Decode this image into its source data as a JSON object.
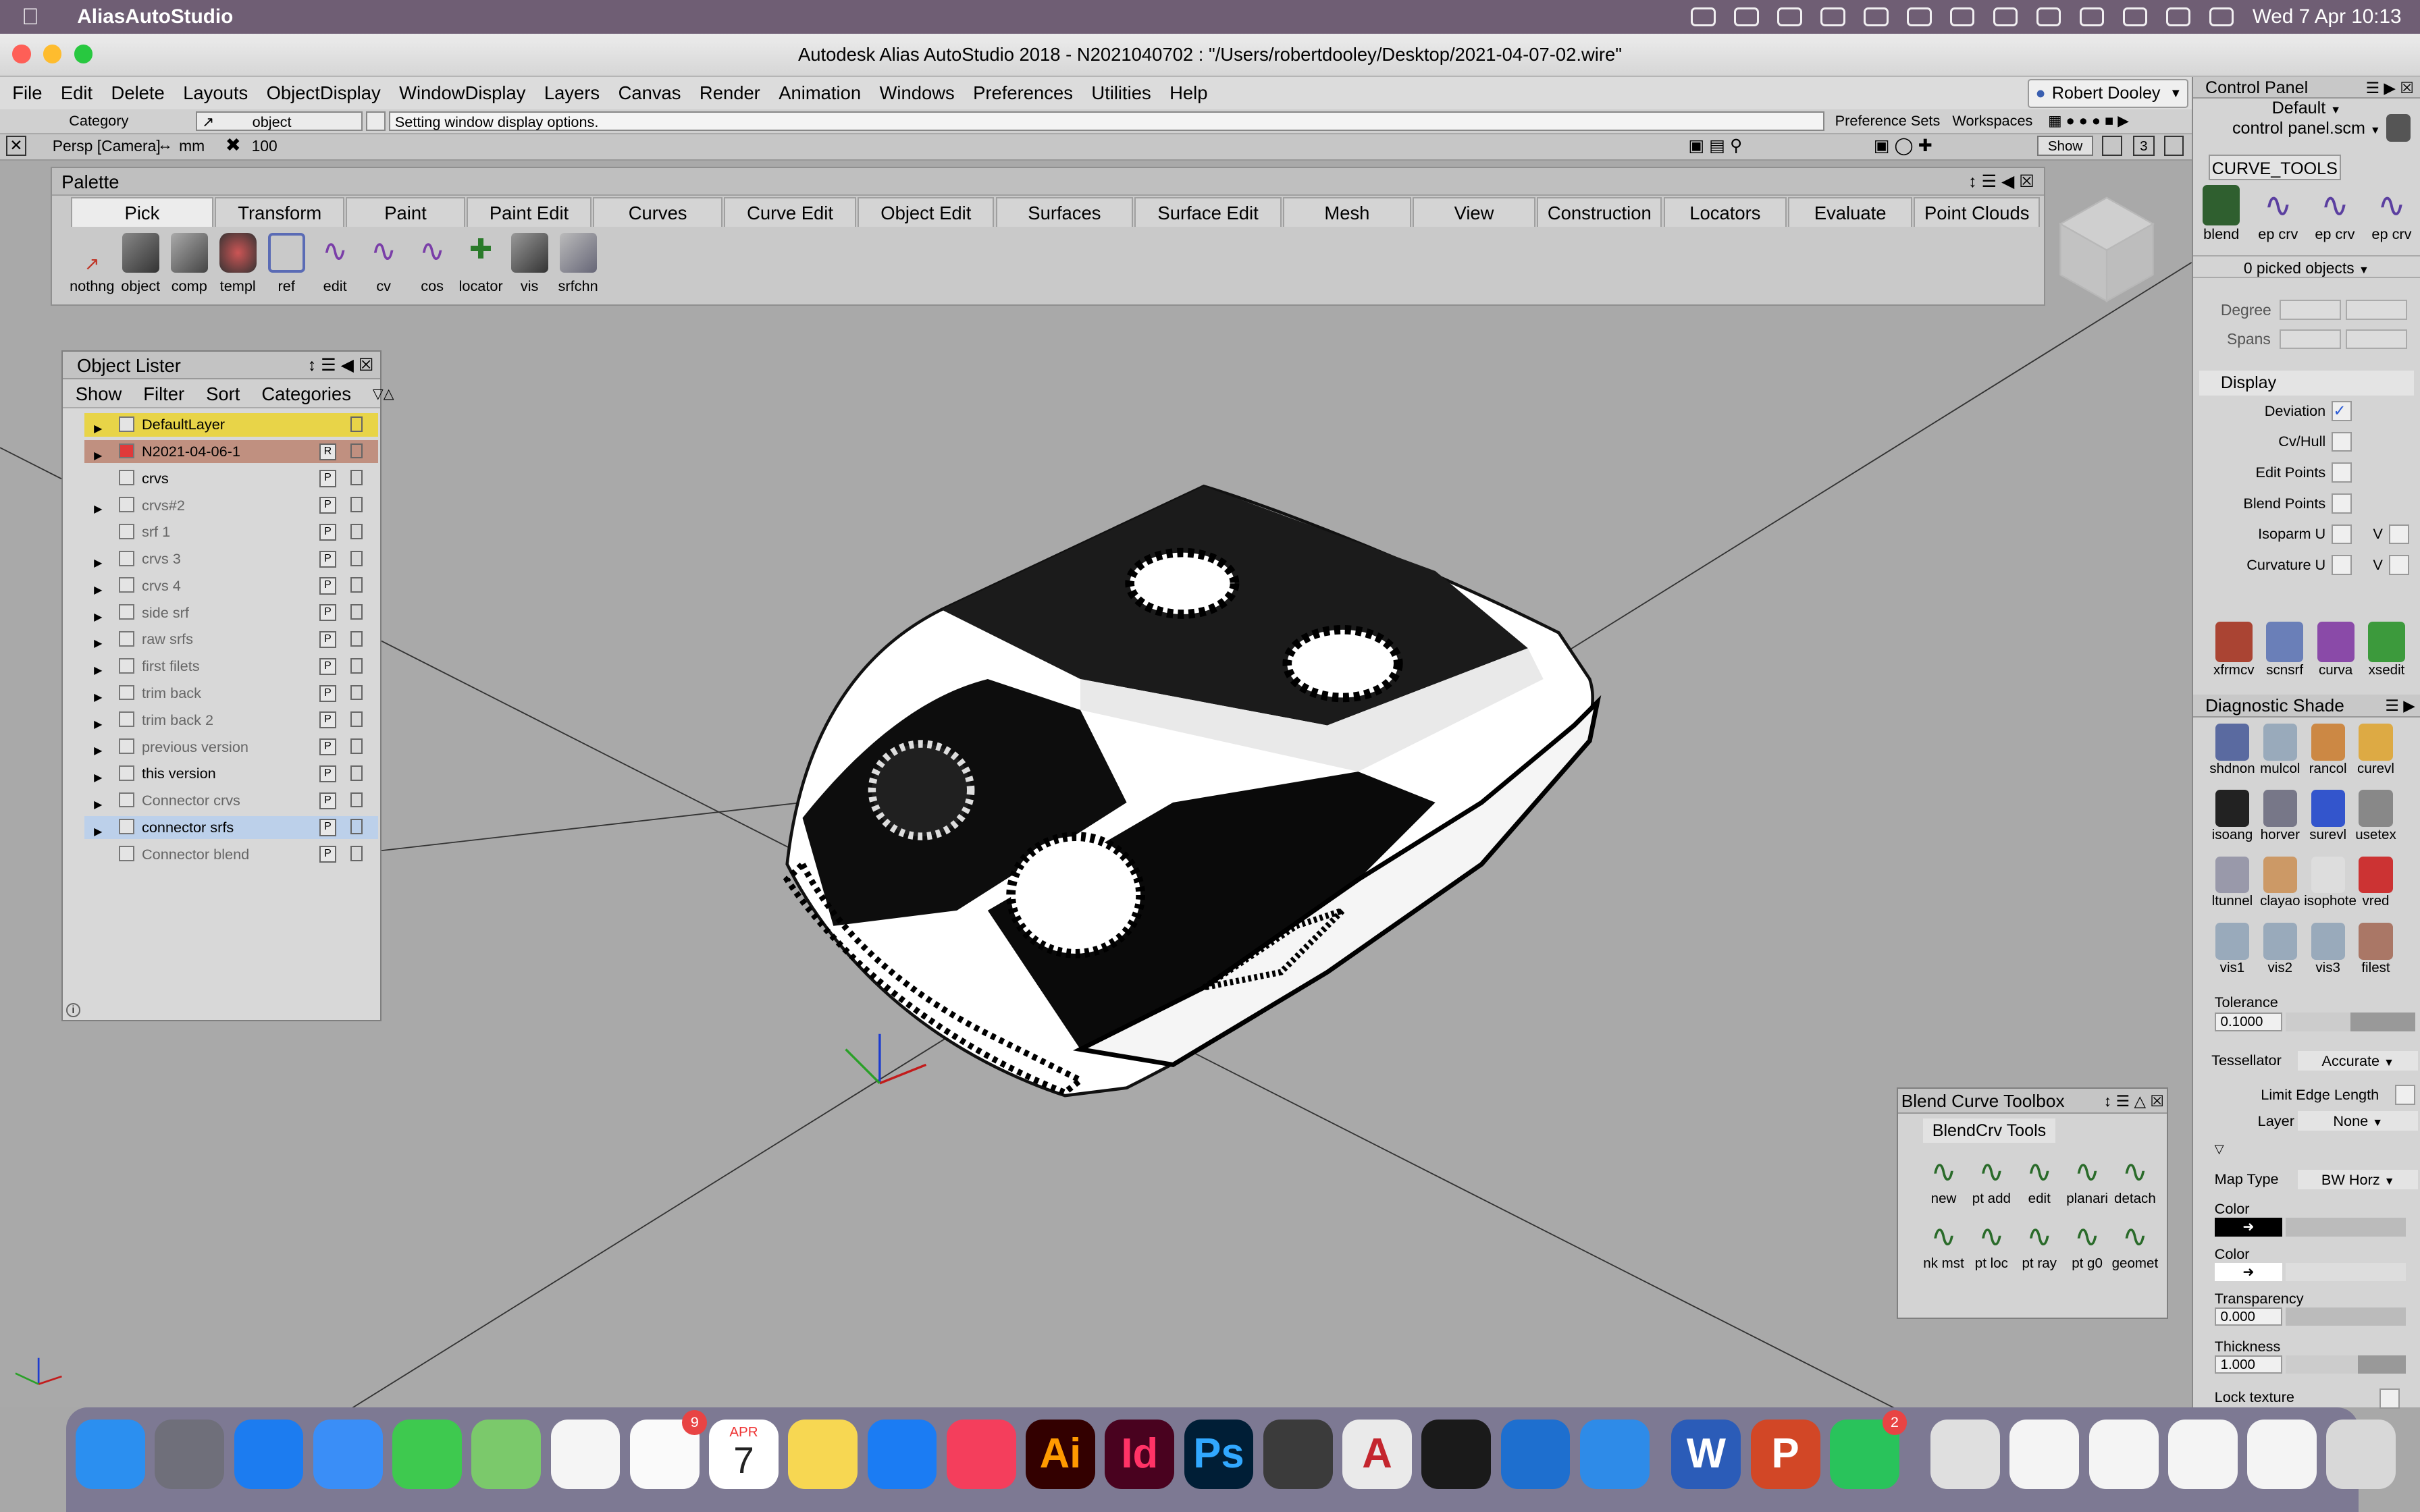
{
  "mac_menubar": {
    "app": "AliasAutoStudio",
    "datetime": "Wed 7 Apr  10:13"
  },
  "window_title": "Autodesk Alias AutoStudio 2018     - N2021040702 : \"/Users/robertdooley/Desktop/2021-04-07-02.wire\"",
  "menu": [
    "File",
    "Edit",
    "Delete",
    "Layouts",
    "ObjectDisplay",
    "WindowDisplay",
    "Layers",
    "Canvas",
    "Render",
    "Animation",
    "Windows",
    "Preferences",
    "Utilities",
    "Help"
  ],
  "user": "Robert Dooley",
  "toolbar": {
    "category_label": "Category",
    "category_value": "object",
    "prompt": "Setting window display options.",
    "pref_sets": "Preference Sets",
    "workspaces": "Workspaces",
    "view_label": "Persp [Camera]",
    "units": "mm",
    "grid_value": "100",
    "show": "Show",
    "num": "3"
  },
  "palette": {
    "title": "Palette",
    "tabs": [
      "Pick",
      "Transform",
      "Paint",
      "Paint Edit",
      "Curves",
      "Curve Edit",
      "Object Edit",
      "Surfaces",
      "Surface Edit",
      "Mesh",
      "View",
      "Construction",
      "Locators",
      "Evaluate",
      "Point Clouds"
    ],
    "tools": [
      "nothng",
      "object",
      "comp",
      "templ",
      "ref",
      "edit",
      "cv",
      "cos",
      "locator",
      "vis",
      "srfchn"
    ]
  },
  "lister": {
    "title": "Object Lister",
    "menu": [
      "Show",
      "Filter",
      "Sort",
      "Categories"
    ],
    "rows": [
      {
        "name": "DefaultLayer",
        "tri": "▶",
        "ltr": "",
        "hl": "yellow"
      },
      {
        "name": "N2021-04-06-1",
        "tri": "▶",
        "ltr": "R",
        "hl": "brown",
        "cb": "red"
      },
      {
        "name": "crvs",
        "tri": "",
        "ltr": "P",
        "hl": ""
      },
      {
        "name": "crvs#2",
        "tri": "▶",
        "ltr": "P",
        "hl": "",
        "grey": true
      },
      {
        "name": "srf 1",
        "tri": "",
        "ltr": "P",
        "hl": "",
        "grey": true
      },
      {
        "name": "crvs 3",
        "tri": "▶",
        "ltr": "P",
        "hl": "",
        "grey": true
      },
      {
        "name": "crvs 4",
        "tri": "▶",
        "ltr": "P",
        "hl": "",
        "grey": true
      },
      {
        "name": "side srf",
        "tri": "▶",
        "ltr": "P",
        "hl": "",
        "grey": true
      },
      {
        "name": "raw srfs",
        "tri": "▶",
        "ltr": "P",
        "hl": "",
        "grey": true
      },
      {
        "name": "first filets",
        "tri": "▶",
        "ltr": "P",
        "hl": "",
        "grey": true
      },
      {
        "name": "trim back",
        "tri": "▶",
        "ltr": "P",
        "hl": "",
        "grey": true
      },
      {
        "name": "trim back 2",
        "tri": "▶",
        "ltr": "P",
        "hl": "",
        "grey": true
      },
      {
        "name": "previous version",
        "tri": "▶",
        "ltr": "P",
        "hl": "",
        "grey": true
      },
      {
        "name": "this version",
        "tri": "▶",
        "ltr": "P",
        "hl": ""
      },
      {
        "name": "Connector crvs",
        "tri": "▶",
        "ltr": "P",
        "hl": "",
        "grey": true
      },
      {
        "name": "connector srfs",
        "tri": "▶",
        "ltr": "P",
        "hl": "blue"
      },
      {
        "name": "Connector blend",
        "tri": "",
        "ltr": "P",
        "hl": "",
        "grey": true
      }
    ]
  },
  "control_panel": {
    "title": "Control Panel",
    "default": "Default",
    "file": "control panel.scm",
    "shelf": "CURVE_TOOLS",
    "curve_tools": [
      "blend",
      "ep crv",
      "ep crv",
      "ep crv"
    ],
    "picked": "0 picked objects",
    "degree": "Degree",
    "spans": "Spans",
    "display": "Display",
    "options": [
      "Deviation",
      "Cv/Hull",
      "Edit Points",
      "Blend Points",
      "Isoparm U",
      "Curvature U"
    ],
    "v": "V",
    "xform": [
      "xfrmcv",
      "scnsrf",
      "curva",
      "xsedit"
    ],
    "diag": "Diagnostic Shade",
    "diag_tools": [
      "shdnon",
      "mulcol",
      "rancol",
      "curevl",
      "isoang",
      "horver",
      "surevl",
      "usetex",
      "ltunnel",
      "clayao",
      "isophote",
      "vred",
      "vis1",
      "vis2",
      "vis3",
      "filest"
    ],
    "tolerance": "Tolerance",
    "tol_value": "0.1000",
    "tessellator": "Tessellator",
    "tess_value": "Accurate",
    "limit": "Limit Edge Length",
    "layer": "Layer",
    "layer_value": "None",
    "map_type": "Map Type",
    "map_value": "BW Horz",
    "color": "Color",
    "transparency": "Transparency",
    "trans_value": "0.000",
    "thickness": "Thickness",
    "thick_value": "1.000",
    "lock": "Lock texture"
  },
  "blend": {
    "title": "Blend Curve Toolbox",
    "tab": "BlendCrv Tools",
    "tools": [
      "new",
      "pt add",
      "edit",
      "planari",
      "detach",
      "nk mst",
      "pt loc",
      "pt ray",
      "pt g0",
      "geomet"
    ]
  },
  "dock": [
    {
      "name": "Finder",
      "bg": "#2b8ff0"
    },
    {
      "name": "System Preferences",
      "bg": "#6f6f7a"
    },
    {
      "name": "Safari",
      "bg": "#1c7cf0"
    },
    {
      "name": "Mail",
      "bg": "#3a8ef7"
    },
    {
      "name": "Messages",
      "bg": "#3ec94f"
    },
    {
      "name": "Maps",
      "bg": "#7bc96b"
    },
    {
      "name": "Photos",
      "bg": "#f5f5f5"
    },
    {
      "name": "Reminders",
      "bg": "#fafafa",
      "badge": "9"
    },
    {
      "name": "Calendar",
      "bg": "#ffffff"
    },
    {
      "name": "Notes",
      "bg": "#f7d752"
    },
    {
      "name": "App Store",
      "bg": "#1b7cf3"
    },
    {
      "name": "Music",
      "bg": "#f43e5c"
    },
    {
      "name": "Illustrator",
      "bg": "#330000",
      "label": "Ai",
      "fg": "#ff9a00"
    },
    {
      "name": "InDesign",
      "bg": "#49021f",
      "label": "Id",
      "fg": "#ff3366"
    },
    {
      "name": "Photoshop",
      "bg": "#001e36",
      "label": "Ps",
      "fg": "#31a8ff"
    },
    {
      "name": "Rhino",
      "bg": "#3b3b3b"
    },
    {
      "name": "Alias AutoStudio",
      "bg": "#eaeaea",
      "label": "A",
      "fg": "#c4262e"
    },
    {
      "name": "Rhino 6",
      "bg": "#1a1a1a"
    },
    {
      "name": "KeyShot",
      "bg": "#1e6fcf"
    },
    {
      "name": "Windows",
      "bg": "#2e8be8"
    },
    {
      "name": "Word",
      "bg": "#2b5cb8",
      "label": "W",
      "fg": "#fff"
    },
    {
      "name": "PowerPoint",
      "bg": "#d24726",
      "label": "P",
      "fg": "#fff"
    },
    {
      "name": "WhatsApp",
      "bg": "#29c35b",
      "badge": "2"
    },
    {
      "name": "Preview",
      "bg": "#dfdfdf"
    },
    {
      "name": "Document 1",
      "bg": "#f4f4f4"
    },
    {
      "name": "Document 2",
      "bg": "#f4f4f4"
    },
    {
      "name": "Document 3",
      "bg": "#f4f4f4"
    },
    {
      "name": "Document 4",
      "bg": "#f4f4f4"
    },
    {
      "name": "Trash",
      "bg": "#d8d8d8"
    }
  ],
  "calendar": {
    "month": "APR",
    "day": "7"
  }
}
